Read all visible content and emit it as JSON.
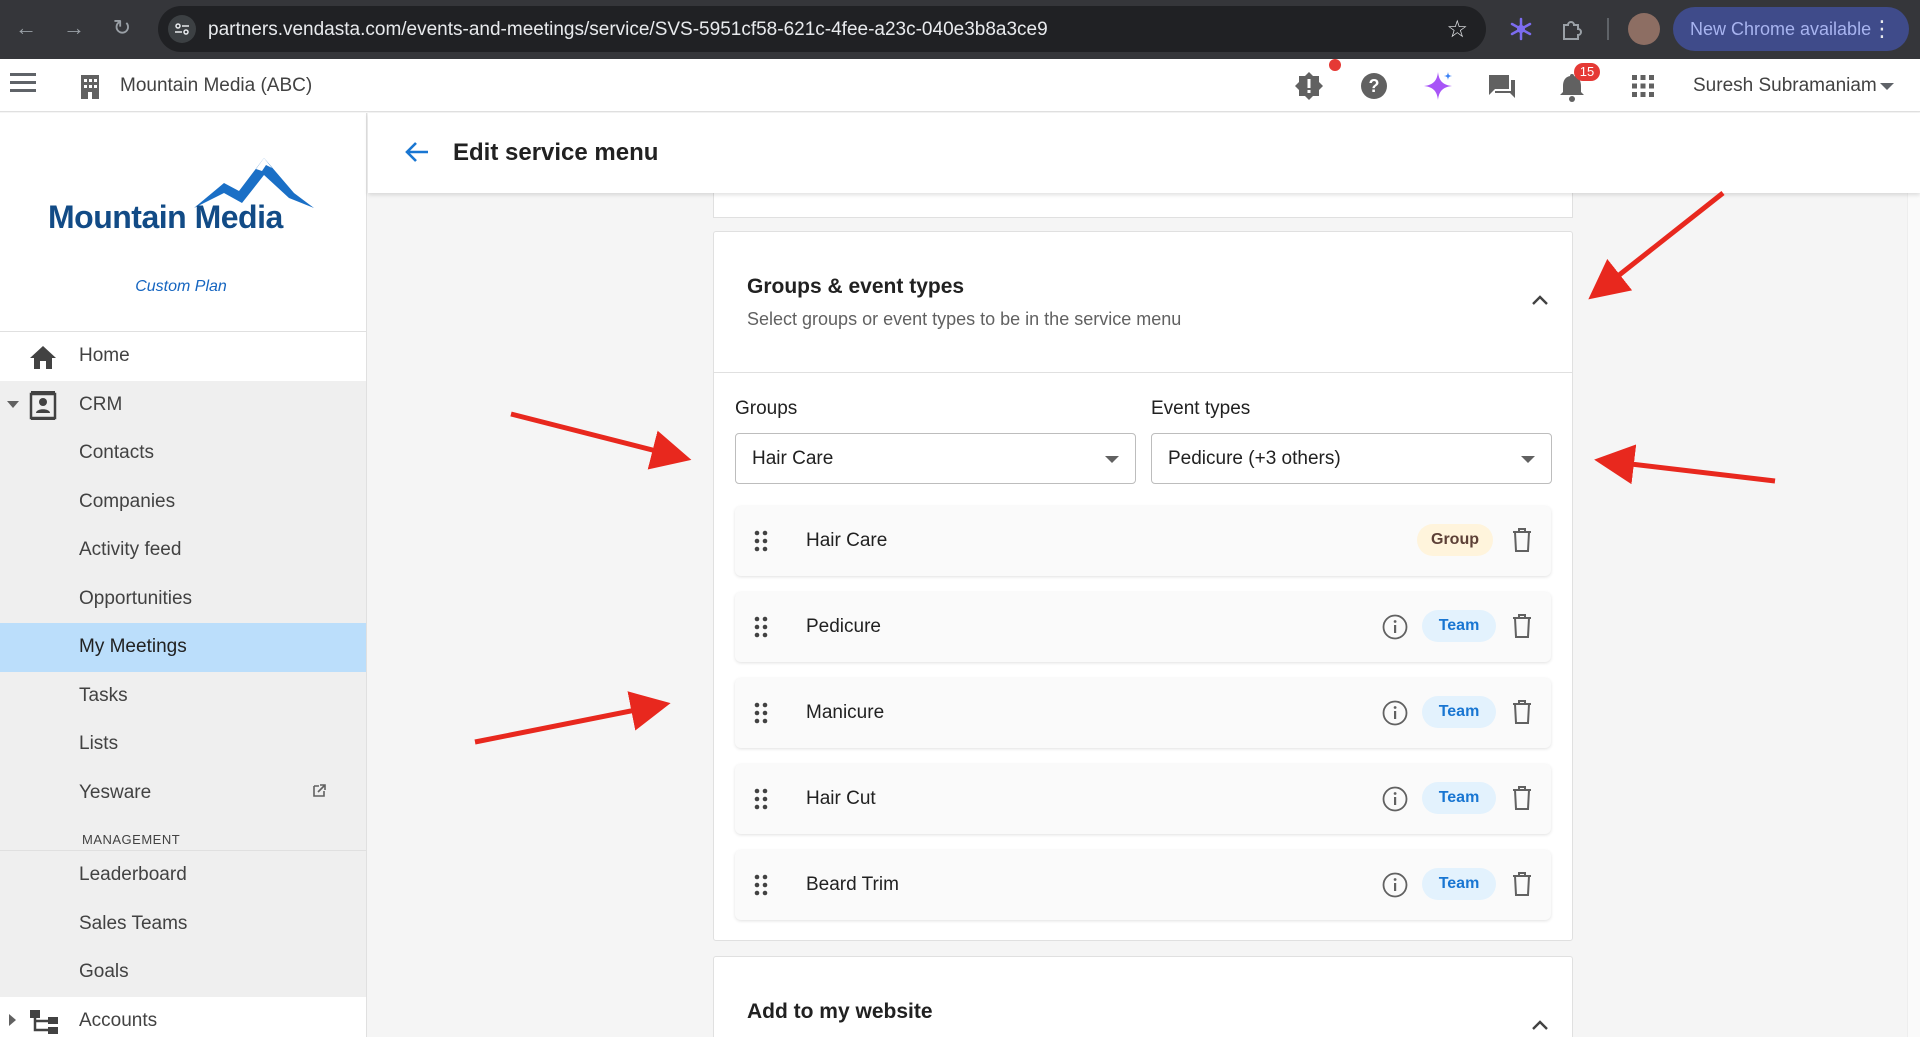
{
  "browser": {
    "url": "partners.vendasta.com/events-and-meetings/service/SVS-5951cf58-621c-4fee-a23c-040e3b8a3ce9",
    "update_label": "New Chrome available"
  },
  "header": {
    "business_name": "Mountain Media (ABC)",
    "notification_count": "15",
    "user_name": "Suresh Subramaniam"
  },
  "sidebar": {
    "logo_text": "Mountain Media",
    "plan": "Custom Plan",
    "home": "Home",
    "crm": "CRM",
    "crm_items": [
      "Contacts",
      "Companies",
      "Activity feed",
      "Opportunities",
      "My Meetings",
      "Tasks",
      "Lists",
      "Yesware"
    ],
    "section_management": "MANAGEMENT",
    "management_items": [
      "Leaderboard",
      "Sales Teams",
      "Goals"
    ],
    "accounts": "Accounts"
  },
  "page": {
    "title": "Edit service menu"
  },
  "groups_card": {
    "title": "Groups & event types",
    "subtitle": "Select groups or event types to be in the service menu",
    "groups_label": "Groups",
    "groups_value": "Hair Care",
    "event_types_label": "Event types",
    "event_types_value": "Pedicure (+3 others)",
    "items": [
      {
        "name": "Hair Care",
        "tag": "Group"
      },
      {
        "name": "Pedicure",
        "tag": "Team"
      },
      {
        "name": "Manicure",
        "tag": "Team"
      },
      {
        "name": "Hair Cut",
        "tag": "Team"
      },
      {
        "name": "Beard Trim",
        "tag": "Team"
      }
    ]
  },
  "website_card": {
    "title": "Add to my website"
  },
  "colors": {
    "brand": "#124b86",
    "active_nav": "#bbdefb",
    "annotation_arrow": "#e8281e"
  }
}
